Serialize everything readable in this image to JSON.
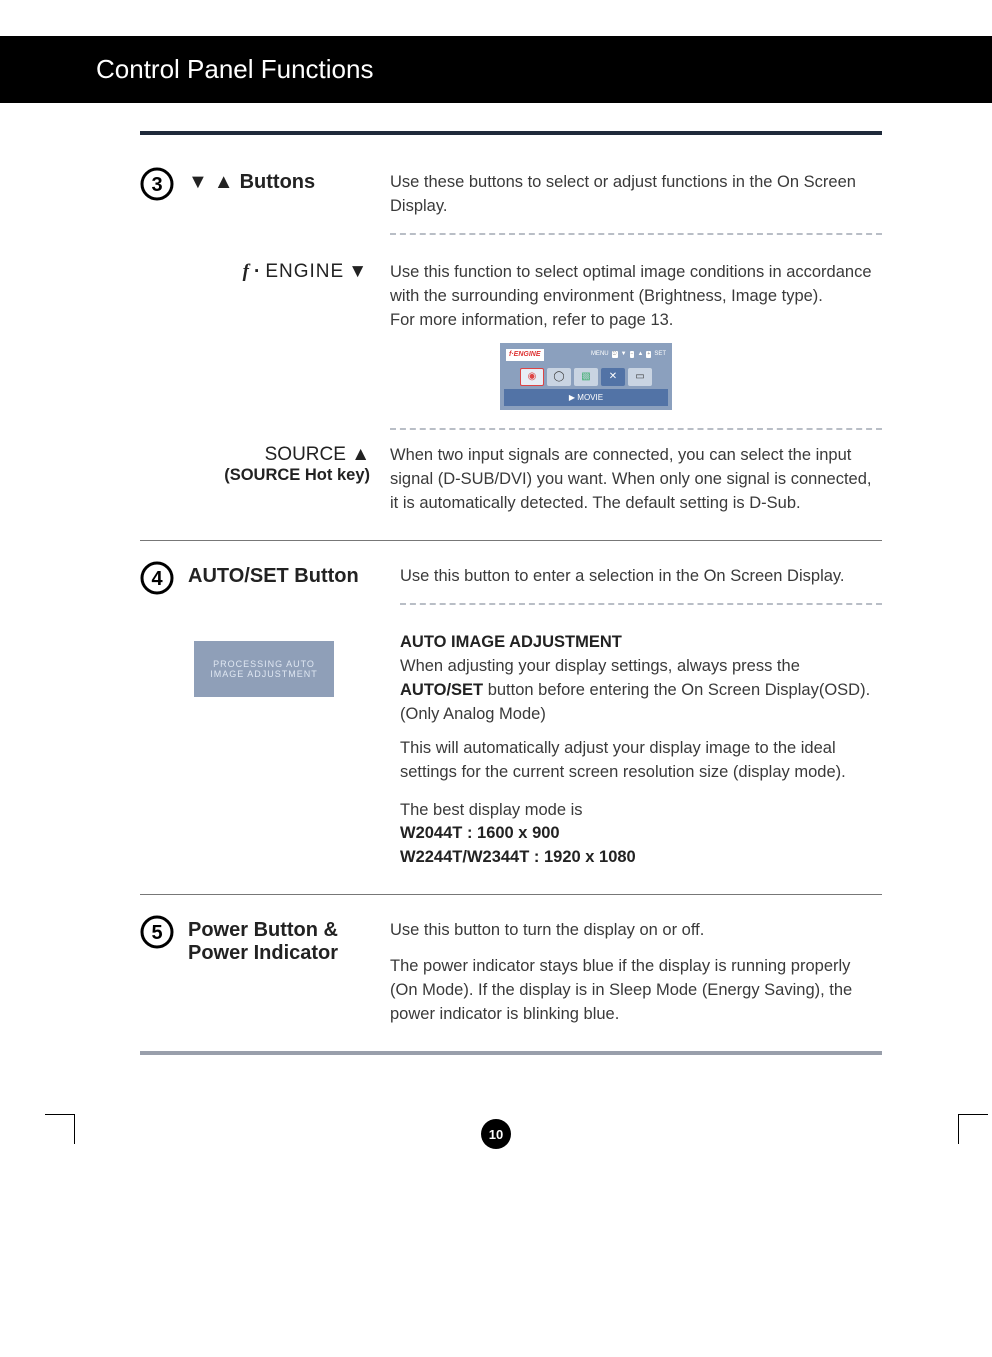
{
  "header": {
    "title": "Control Panel Functions"
  },
  "section3": {
    "buttons_label": "Buttons",
    "buttons_desc": "Use these buttons to select or adjust functions in the On Screen Display.",
    "fengine_label": "ENGINE",
    "fengine_desc": "Use this function to select optimal image conditions in accordance with the surrounding environment (Brightness, Image type).\nFor more information, refer to page 13.",
    "osd": {
      "fe": "f·ENGINE",
      "menu": "MENU",
      "set": "SET",
      "bottom": "▶  MOVIE"
    },
    "source_label": "SOURCE ▲",
    "source_sub": "(SOURCE Hot key)",
    "source_desc": "When two input signals are connected, you can select the input signal (D-SUB/DVI) you want. When only one signal is connected, it is automatically detected. The default setting is D-Sub."
  },
  "section4": {
    "title": "AUTO/SET Button",
    "desc": "Use this button to enter a selection in the On Screen Display.",
    "aia_title": "AUTO IMAGE ADJUSTMENT",
    "aia_p1_a": "When adjusting your display settings, always press the ",
    "aia_p1_b": "AUTO/SET",
    "aia_p1_c": " button before entering the On Screen Display(OSD). (Only Analog Mode)",
    "aia_p2": "This will automatically adjust your display image to the ideal settings for the current screen resolution size (display mode).",
    "best_a": "The best display mode is",
    "best_b": "W2044T : 1600 x 900",
    "best_c": "W2244T/W2344T : 1920 x 1080",
    "proc1": "PROCESSING AUTO",
    "proc2": "IMAGE ADJUSTMENT"
  },
  "section5": {
    "title": "Power Button & Power Indicator",
    "p1": "Use this button to turn the display on or off.",
    "p2": "The power indicator stays blue if the display is running properly (On Mode). If the display is in Sleep Mode (Energy Saving), the power indicator is blinking blue."
  },
  "page_number": "10"
}
